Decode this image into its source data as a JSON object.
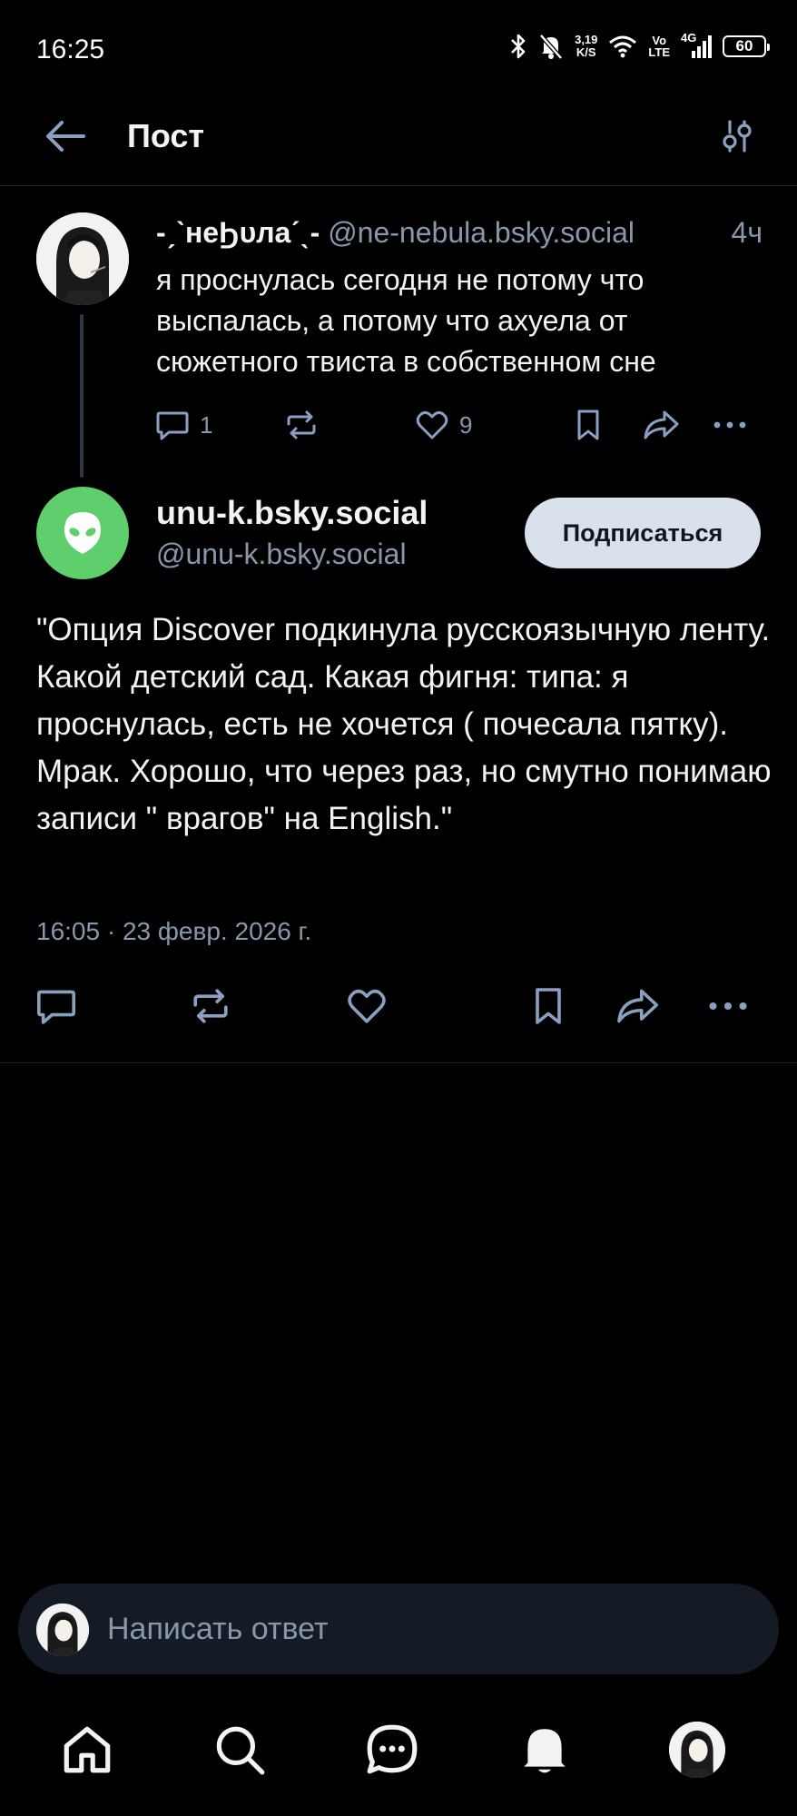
{
  "status_bar": {
    "time": "16:25",
    "speed_value": "3,19",
    "speed_unit": "K/S",
    "volte_top": "Vo",
    "volte_bottom": "LTE",
    "network": "4G",
    "battery": "60"
  },
  "header": {
    "title": "Пост",
    "back_icon": "arrow-left-icon",
    "filter_icon": "sliders-icon"
  },
  "parent_post": {
    "author_name": "-ˏˋнеϦυлаˊˎ-",
    "author_handle": "@ne-nebula.bsky.social",
    "time_ago": "4ч",
    "text": "я проснулась сегодня не потому что выспалась, а потому что ахуела от сюжетного твиста в собственном сне",
    "reply_count": "1",
    "like_count": "9"
  },
  "main_post": {
    "author_name": "unu-k.bsky.social",
    "author_handle": "@unu-k.bsky.social",
    "follow_label": "Подписаться",
    "text": "\"Опция Discover подкинула русскоязычную ленту. Какой детский сад. Какая фигня: типа: я проснулась, есть не хочется ( почесала пятку). Мрак. Хорошо, что через раз, но смутно понимаю записи \" врагов\" на English.\"",
    "date": "16:05 · 23 февр. 2026 г."
  },
  "reply_bar": {
    "placeholder": "Написать ответ"
  },
  "colors": {
    "background": "#000000",
    "muted_text": "#8897ab",
    "icon_blue": "#8aa0c0",
    "follow_bg": "#d9e1ec",
    "default_avatar": "#5fcf6e"
  }
}
